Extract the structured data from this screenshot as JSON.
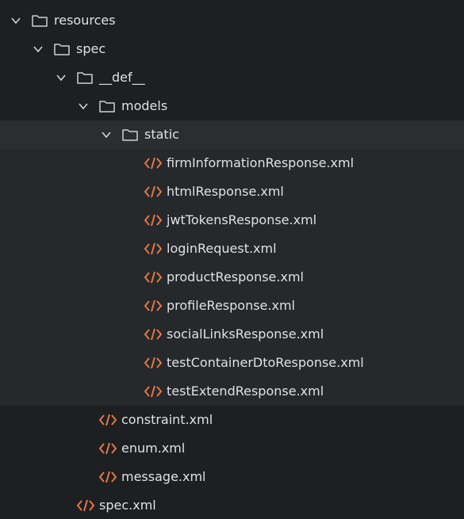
{
  "tree": {
    "folders": [
      {
        "label": "resources",
        "icon": "folder-icon",
        "expanded": true
      },
      {
        "label": "spec",
        "icon": "folder-icon",
        "expanded": true
      },
      {
        "label": "__def__",
        "icon": "folder-icon",
        "expanded": true
      },
      {
        "label": "models",
        "icon": "folder-icon",
        "expanded": true
      },
      {
        "label": "static",
        "icon": "folder-icon",
        "expanded": true
      }
    ],
    "static_files": [
      "firmInformationResponse.xml",
      "htmlResponse.xml",
      "jwtTokensResponse.xml",
      "loginRequest.xml",
      "productResponse.xml",
      "profileResponse.xml",
      "socialLinksResponse.xml",
      "testContainerDtoResponse.xml",
      "testExtendResponse.xml"
    ],
    "def_files": [
      "constraint.xml",
      "enum.xml",
      "message.xml"
    ],
    "spec_files": [
      "spec.xml"
    ]
  },
  "colors": {
    "background": "#1e1f22",
    "text": "#dfe1e5",
    "chevron": "#cfd1d4",
    "folder_stroke": "#cfd1d4",
    "xml_icon": "#e07a45"
  }
}
